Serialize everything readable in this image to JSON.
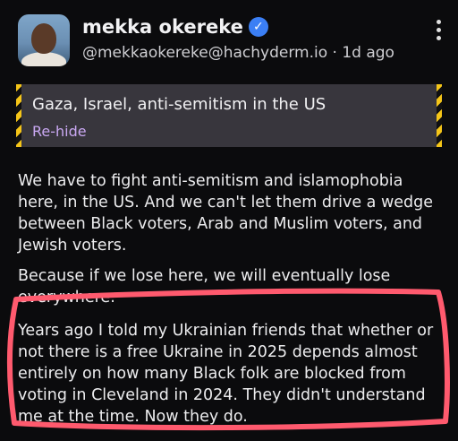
{
  "post": {
    "author_name": "mekka okereke",
    "handle": "@mekkaokereke@hachyderm.io",
    "separator": "·",
    "time": "1d ago",
    "verified_glyph": "✓"
  },
  "content_warning": {
    "title": "Gaza, Israel, anti-semitism in the US",
    "button_label": "Re-hide"
  },
  "body": {
    "paragraphs": [
      "We have to fight anti-semitism and islamophobia here, in the US. And we can't let them drive a wedge between Black voters, Arab and Muslim voters, and Jewish voters.",
      "Because if we lose here, we will eventually lose everywhere.",
      "Years ago I told my Ukrainian friends that whether or not there is a free Ukraine in 2025 depends almost entirely on how many Black folk are blocked from voting in Cleveland in 2024. They didn't understand me at the time. Now they do."
    ]
  },
  "annotation": {
    "color": "#ff5a6e"
  },
  "icons": {
    "more": "more-vertical-icon",
    "verified": "verified-badge-icon",
    "avatar": "avatar"
  }
}
